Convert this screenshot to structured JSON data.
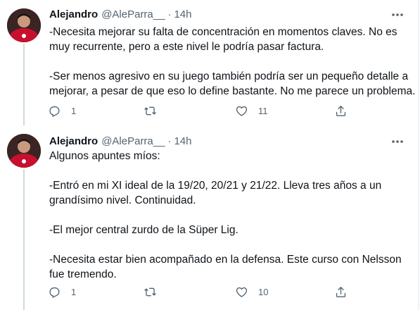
{
  "tweets": [
    {
      "author": {
        "name": "Alejandro",
        "handle": "@AleParra__"
      },
      "separator": "·",
      "time": "14h",
      "lines": [
        "-Necesita mejorar su falta de concentración en momentos claves. No es",
        "muy recurrente, pero a este nivel le podría pasar factura.",
        "",
        "-Ser menos agresivo en su juego también podría ser un pequeño detalle a",
        "mejorar, a pesar de que eso lo define bastante. No me parece un problema."
      ],
      "actions": {
        "replies": "1",
        "retweets": "",
        "likes": "11"
      }
    },
    {
      "author": {
        "name": "Alejandro",
        "handle": "@AleParra__"
      },
      "separator": "·",
      "time": "14h",
      "lines": [
        "Algunos apuntes míos:",
        "",
        "-Entró en mi XI ideal de la 19/20, 20/21 y 21/22. Lleva tres años a un",
        "grandísimo nivel. Continuidad.",
        "",
        "-El mejor central zurdo de la Süper Lig.",
        "",
        "-Necesita estar bien acompañado en la defensa. Este curso con Nelsson",
        "fue tremendo."
      ],
      "actions": {
        "replies": "1",
        "retweets": "",
        "likes": "10"
      }
    }
  ],
  "icons": {
    "reply": "reply-icon",
    "retweet": "retweet-icon",
    "like": "heart-icon",
    "share": "share-icon",
    "more": "more-icon"
  },
  "colors": {
    "text": "#0f1419",
    "secondary": "#536471",
    "thread_line": "#cfd9de",
    "avatar_shirt": "#c8102e"
  }
}
